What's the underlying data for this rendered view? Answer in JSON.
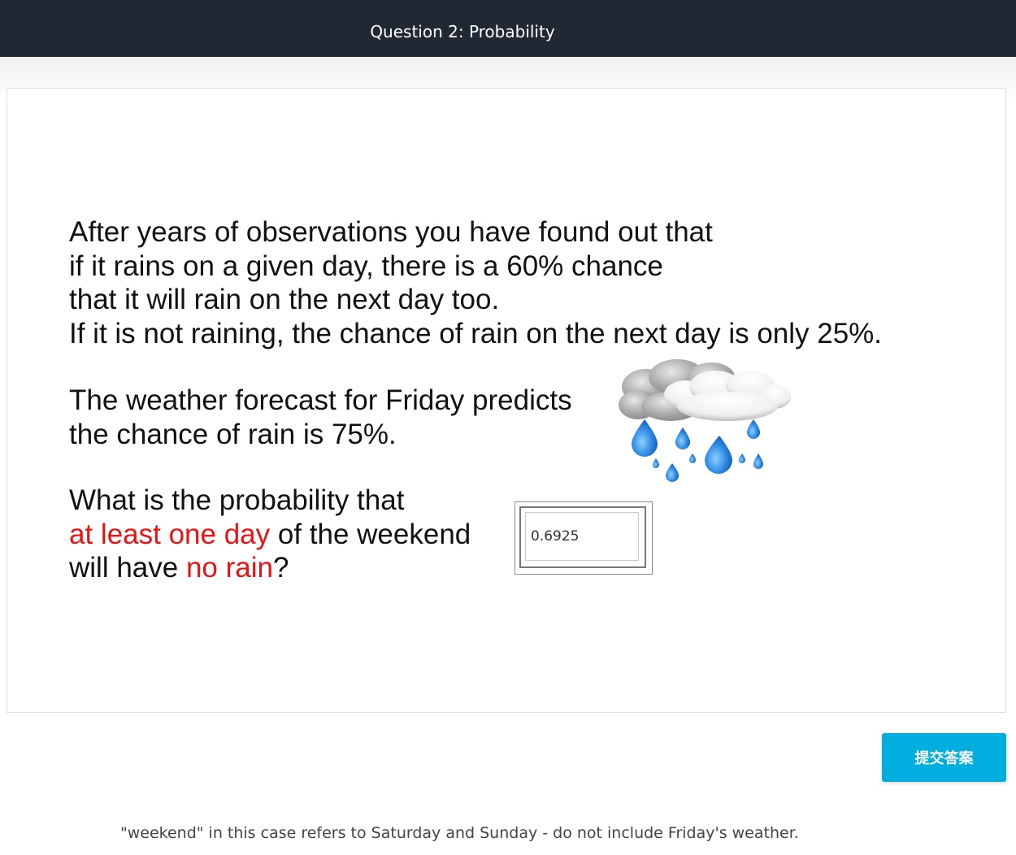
{
  "header": {
    "title": "Question 2: Probability"
  },
  "question": {
    "para1": [
      "After years of observations you have found out that",
      "if it rains on a given day, there is a 60% chance",
      "that it will rain on the next day too.",
      "If it is not raining, the chance of rain on the next day is only 25%."
    ],
    "para2": [
      "The weather forecast for Friday predicts",
      "the chance of rain is 75%."
    ],
    "para3": {
      "line1": "What is the probability that",
      "line2_red": "at least one day",
      "line2_rest": " of the weekend",
      "line3_start": "will have ",
      "line3_red": "no rain",
      "line3_end": "?"
    },
    "highlight_color": "#ee1111"
  },
  "answer": {
    "value": "0.6925"
  },
  "illustration": {
    "icon": "rain-cloud-icon"
  },
  "submit": {
    "label": "提交答案",
    "color": "#00aee0"
  },
  "hint": {
    "text": "\"weekend\" in this case refers to Saturday and Sunday - do not include Friday's weather."
  }
}
